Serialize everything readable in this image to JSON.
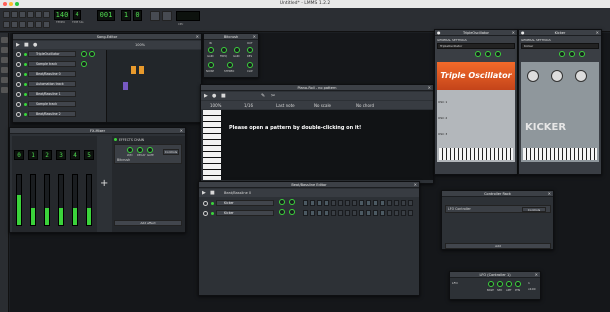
{
  "window": {
    "title": "Untitled* - LMMS 1.2.2"
  },
  "toolbar": {
    "lcd_primary": "140",
    "lcd_primary_label": "TEMPO",
    "lcd_time": "4",
    "lcd_sig_label": "TIME SIG",
    "lcd_bars": "001",
    "lcd_beats": "1",
    "lcd_ticks": "0",
    "cpu_label": "CPU"
  },
  "song_editor": {
    "title": "Song-Editor",
    "zoom": "100%",
    "tracks": [
      {
        "name": "TripleOscillator"
      },
      {
        "name": "Sample track"
      },
      {
        "name": "Beat/Bassline 0"
      },
      {
        "name": "Automation track"
      },
      {
        "name": "Beat/Bassline 1"
      },
      {
        "name": "Sample track"
      },
      {
        "name": "Beat/Bassline 2"
      }
    ],
    "vol_label": "VOL",
    "pan_label": "PAN"
  },
  "bitcrush": {
    "title": "Bitcrush",
    "labels": [
      "IN",
      "OUT",
      "GAIN",
      "FREQ",
      "GAIN",
      "RES",
      "NOISE",
      "STEREO",
      "CLIP",
      "DEPTH",
      "LEVELS"
    ]
  },
  "fx_mixer": {
    "title": "FX-Mixer",
    "channels": [
      "0",
      "1",
      "2",
      "3",
      "4",
      "5"
    ],
    "effects_chain": "EFFECTS CHAIN",
    "effect": "Bitcrush",
    "controls": "Controls",
    "knobs": [
      "W/D",
      "DECAY",
      "GATE"
    ],
    "add_effect": "Add effect",
    "master": "Master"
  },
  "piano_roll": {
    "title": "Piano-Roll - no pattern",
    "message": "Please open a pattern by double-clicking on it!",
    "zoom": "100%",
    "quant": "1/16",
    "note_len": "Last note",
    "scale": "No scale",
    "chord": "No chord",
    "stretch": "1"
  },
  "triple_osc": {
    "title": "TripleOscillator",
    "tab": "GENERAL SETTINGS",
    "name": "TripleOscillator",
    "logo": "Triple Oscillator",
    "vol": "VOL",
    "pan": "PAN",
    "pitch": "PITCH",
    "range": "RANGE",
    "osc_labels": [
      "OSC 1",
      "OSC 2",
      "OSC 3"
    ]
  },
  "kicker": {
    "title": "Kicker",
    "tab": "GENERAL SETTINGS",
    "name": "Kicker",
    "logo": "KICKER",
    "vol": "VOL",
    "pan": "PAN",
    "pitch": "PITCH"
  },
  "bb_editor": {
    "title": "Beat/Bassline Editor",
    "bb": "Beat/Bassline 0",
    "tracks": [
      {
        "name": "Kicker"
      },
      {
        "name": "Kicker"
      }
    ],
    "step_lit": [
      [
        1,
        1,
        1,
        1,
        0,
        0,
        0,
        0,
        1,
        1,
        1,
        1,
        0,
        0,
        0,
        0
      ],
      [
        1,
        1,
        1,
        1,
        0,
        0,
        0,
        0,
        1,
        1,
        1,
        1,
        0,
        0,
        0,
        0
      ]
    ]
  },
  "controller_rack": {
    "title": "Controller Rack",
    "item": "LFO Controller",
    "controls": "Controls",
    "add": "Add"
  },
  "lfo": {
    "title": "LFO (Controller 1)",
    "labels": [
      "BASE",
      "SPD",
      "AMT",
      "PHS"
    ],
    "left": "LFO",
    "f1": "1",
    "f2": "x100"
  },
  "colors": {
    "accent": "#3bd33b",
    "bg": "#15171a"
  }
}
